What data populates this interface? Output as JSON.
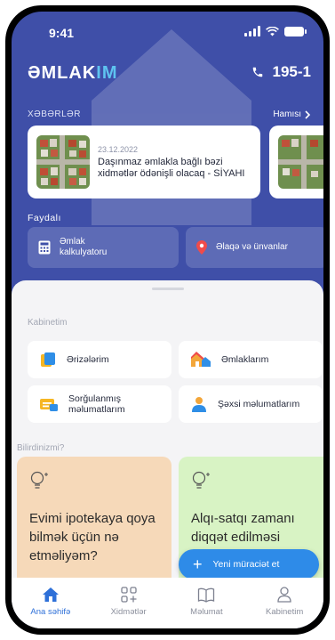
{
  "status_bar": {
    "time": "9:41"
  },
  "header": {
    "logo_main": "ƏMLAK",
    "logo_accent": "IM",
    "phone": "195-1"
  },
  "news": {
    "label": "XƏBƏRLƏR",
    "see_all": "Hamısı",
    "items": [
      {
        "date": "23.12.2022",
        "title": "Daşınmaz əmlakla bağlı bəzi xidmətlər ödənişli olacaq - SİYAHI"
      }
    ]
  },
  "useful": {
    "label": "Faydalı",
    "items": [
      {
        "label": "Əmlak kalkulyatoru",
        "icon": "calculator-icon"
      },
      {
        "label": "Əlaqə və ünvanlar",
        "icon": "location-pin-icon"
      }
    ]
  },
  "cabinet": {
    "label": "Kabinetim",
    "items": [
      {
        "label": "Ərizələrim",
        "icon": "document-icon"
      },
      {
        "label": "Əmlaklarım",
        "icon": "houses-icon"
      },
      {
        "label": "Sorğulanmış məlumatlarım",
        "icon": "query-icon"
      },
      {
        "label": "Şəxsi məlumatlarım",
        "icon": "person-icon"
      }
    ]
  },
  "tips": {
    "label": "Bilirdinizmi?",
    "items": [
      {
        "text": "Evimi ipotekaya qoya bilmək üçün nə etməliyəm?",
        "color": "#f6d9b9"
      },
      {
        "text": "Alqı-satqı zamanı diqqət edilməsi",
        "color": "#d8f3c4"
      }
    ]
  },
  "fab": {
    "label": "Yeni müraciət et"
  },
  "tabs": [
    {
      "label": "Ana səhifə",
      "icon": "home-icon",
      "active": true
    },
    {
      "label": "Xidmətlər",
      "icon": "grid-plus-icon",
      "active": false
    },
    {
      "label": "Məlumat",
      "icon": "book-icon",
      "active": false
    },
    {
      "label": "Kabinetim",
      "icon": "user-icon",
      "active": false
    }
  ],
  "colors": {
    "brand": "#3f4fa8",
    "accent": "#5ec3f0",
    "primary": "#2e8be8"
  }
}
